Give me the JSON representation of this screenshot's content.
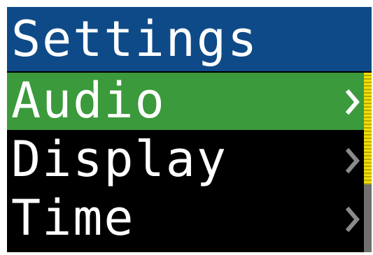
{
  "header": {
    "title": "Settings"
  },
  "menu": {
    "items": [
      {
        "label": "Audio",
        "selected": true,
        "icon": "chevron-right-icon"
      },
      {
        "label": "Display",
        "selected": false,
        "icon": "chevron-right-icon"
      },
      {
        "label": "Time",
        "selected": false,
        "icon": "chevron-right-icon"
      }
    ]
  },
  "colors": {
    "header_bg": "#0e4a87",
    "selected_bg": "#3b9a3b",
    "background": "#000000",
    "text": "#ffffff",
    "chevron_active": "#ffffff",
    "chevron_inactive": "#8a8a8a",
    "scroll_thumb": "#e8d400",
    "scroll_track": "#6f6f6f"
  }
}
